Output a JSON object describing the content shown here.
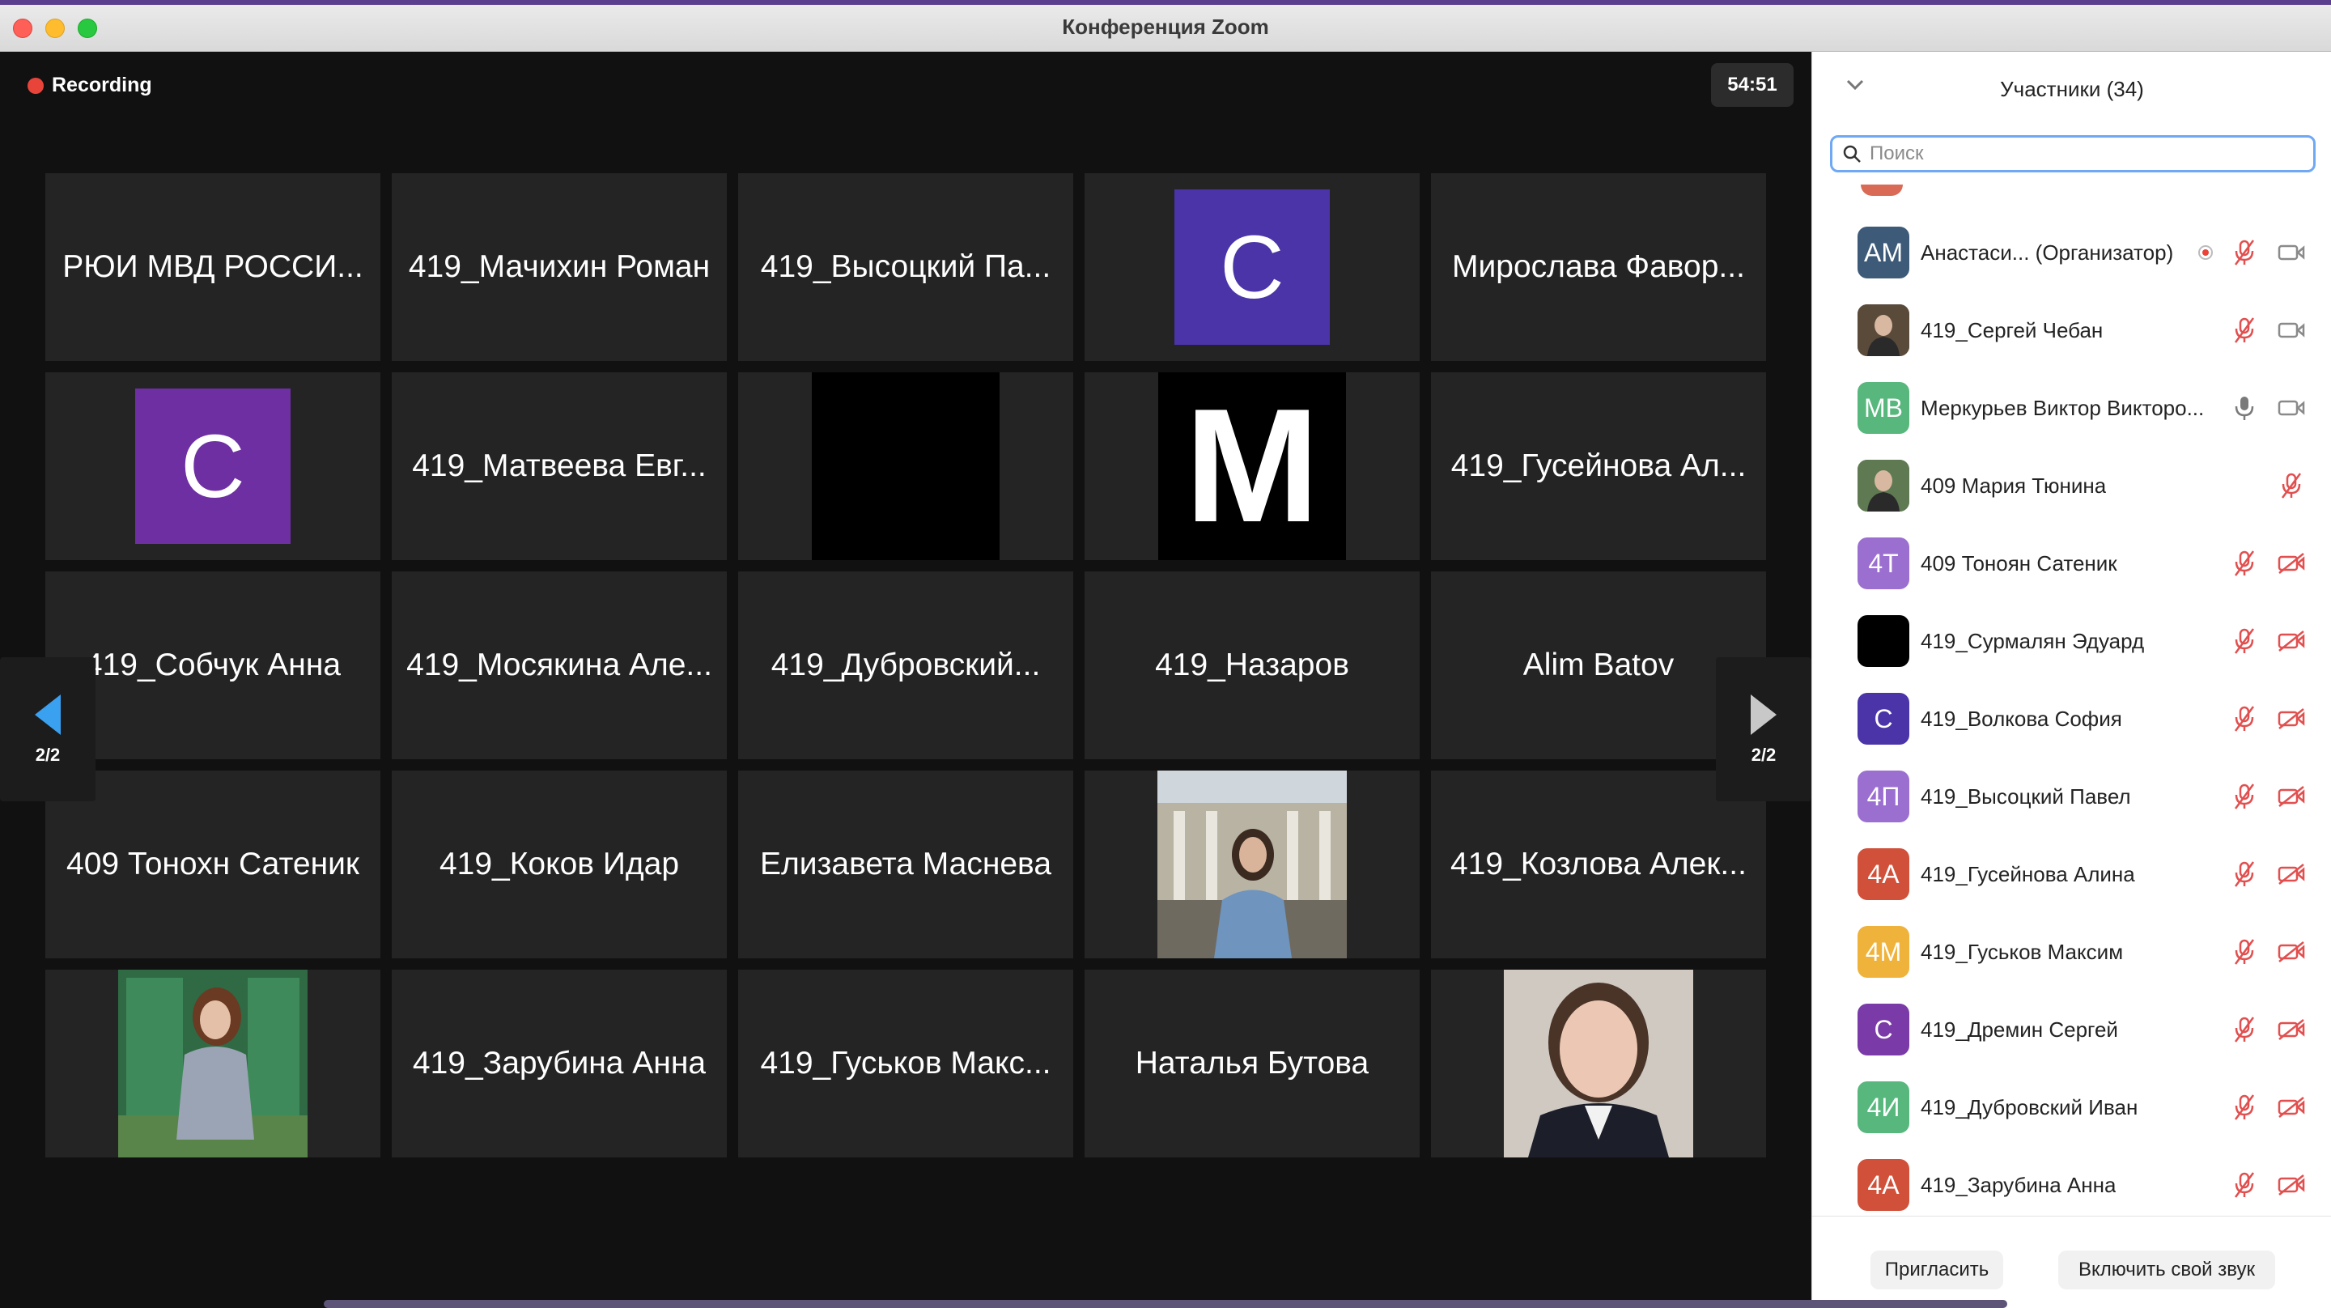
{
  "window": {
    "title": "Конференция Zoom"
  },
  "recording": {
    "label": "Recording"
  },
  "timer": "54:51",
  "colors": {
    "accent": "#6fa8f4",
    "recording": "#e8443a",
    "muted": "#e24f4f"
  },
  "pages": {
    "left": "2/2",
    "right": "2/2"
  },
  "tiles": [
    {
      "name": "РЮИ МВД РОССИ..."
    },
    {
      "name": "419_Мачихин Роман"
    },
    {
      "name": "419_Высоцкий Па..."
    },
    {
      "avatar_letter": "C",
      "avatar_color": "#4b34a8"
    },
    {
      "name": "Мирослава Фавор..."
    },
    {
      "avatar_letter": "C",
      "avatar_color": "#6e2fa3"
    },
    {
      "name": "419_Матвеева Евг..."
    },
    {
      "black": true
    },
    {
      "big_letter": "M"
    },
    {
      "name": "419_Гусейнова Ал..."
    },
    {
      "name": "419_Собчук Анна"
    },
    {
      "name": "419_Мосякина Але..."
    },
    {
      "name": "419_Дубровский..."
    },
    {
      "name": "419_Назаров"
    },
    {
      "name": "Alim Batov"
    },
    {
      "name": "409 Тонохн Сатеник"
    },
    {
      "name": "419_Коков Идар"
    },
    {
      "name": "Елизавета Маснева"
    },
    {
      "photo": "photo-woman-building"
    },
    {
      "name": "419_Козлова Алек..."
    },
    {
      "photo": "photo-woman-window"
    },
    {
      "name": "419_Зарубина Анна"
    },
    {
      "name": "419_Гуськов Макс..."
    },
    {
      "name": "Наталья Бутова"
    },
    {
      "photo": "photo-woman-uniform"
    }
  ],
  "panel": {
    "title": "Участники (34)",
    "search_placeholder": "Поиск",
    "participants": [
      {
        "initials": "AM",
        "color": "#3d5a78",
        "name": "Анастаси... (Организатор)",
        "recording": true,
        "mic": "muted",
        "cam": "on"
      },
      {
        "photo": true,
        "color": "#5a4a3a",
        "name": "419_Сергей Чебан",
        "mic": "muted",
        "cam": "on"
      },
      {
        "initials": "MB",
        "color": "#57b77d",
        "name": "Меркурьев Виктор Викторо...",
        "mic": "on",
        "cam": "on"
      },
      {
        "photo": true,
        "color": "#5f7a52",
        "name": "409 Мария Тюнина",
        "mic": "muted",
        "cam": "none"
      },
      {
        "initials": "4T",
        "color": "#9b6fd0",
        "name": "409 Тоноян Сатеник",
        "mic": "muted",
        "cam": "off"
      },
      {
        "initials": "",
        "color": "#000000",
        "name": "419_Сурмалян Эдуард",
        "mic": "muted",
        "cam": "off"
      },
      {
        "initials": "C",
        "color": "#4b34a8",
        "name": "419_Волкова София",
        "mic": "muted",
        "cam": "off"
      },
      {
        "initials": "4П",
        "color": "#9b6fd0",
        "name": "419_Высоцкий Павел",
        "mic": "muted",
        "cam": "off"
      },
      {
        "initials": "4А",
        "color": "#d0503a",
        "name": "419_Гусейнова Алина",
        "mic": "muted",
        "cam": "off"
      },
      {
        "initials": "4М",
        "color": "#efb23a",
        "name": "419_Гуськов Максим",
        "mic": "muted",
        "cam": "off"
      },
      {
        "initials": "C",
        "color": "#7a3aa8",
        "name": "419_Дремин Сергей",
        "mic": "muted",
        "cam": "off"
      },
      {
        "initials": "4И",
        "color": "#57b77d",
        "name": "419_Дубровский Иван",
        "mic": "muted",
        "cam": "off"
      },
      {
        "initials": "4А",
        "color": "#d0503a",
        "name": "419_Зарубина Анна",
        "mic": "muted",
        "cam": "off"
      }
    ],
    "invite_label": "Пригласить",
    "unmute_label": "Включить свой звук"
  }
}
